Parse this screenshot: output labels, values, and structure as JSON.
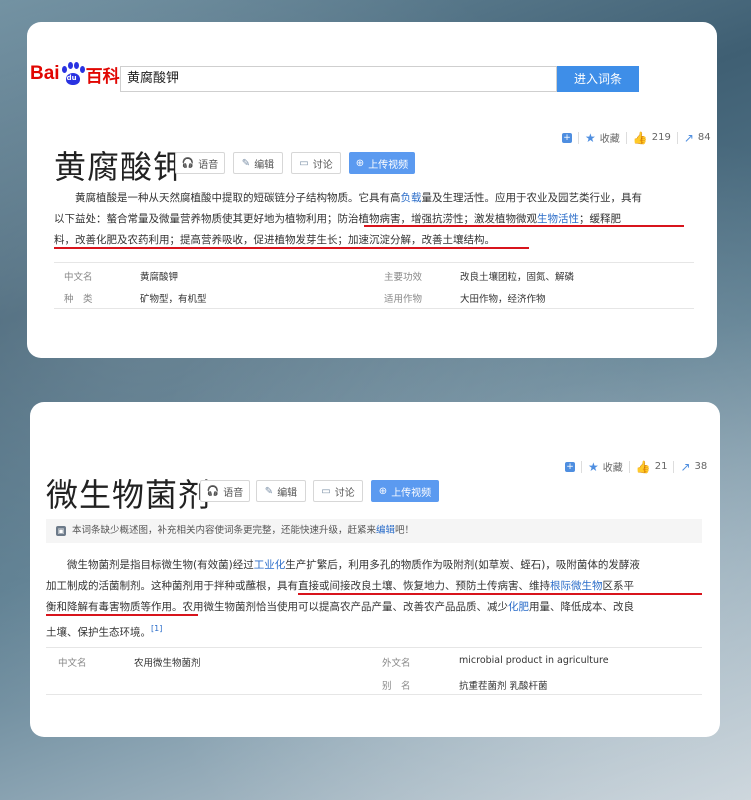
{
  "search": {
    "logo_bai": "Bai",
    "logo_du": "du",
    "logo_baike": "百科",
    "query": "黄腐酸钾",
    "button": "进入词条"
  },
  "entry1": {
    "toolbar": {
      "plus": "+",
      "collect": "收藏",
      "likes": "219",
      "shares": "84"
    },
    "title": "黄腐酸钾",
    "buttons": {
      "audio": "语音",
      "edit": "编辑",
      "discuss": "讨论",
      "upload": "上传视频"
    },
    "para_lines": [
      [
        "黄腐植酸是一种从天然腐植酸中提取的短碳链分子结构物质。它具有高",
        {
          "link": "负载"
        },
        "量及生理活性。应用于农业及园艺类行业，具有"
      ],
      [
        "以下益处：螯合常量及微量营养物质使其更好地为植物利用；防治植物病害，增强抗涝性；激发植物微观",
        {
          "link": "生物活性"
        },
        "；缓释肥"
      ],
      [
        "料，改善化肥及农药利用；提高营养吸收，促进植物发芽生长；加速沉淀分解，改善土壤结构。"
      ]
    ],
    "info": [
      {
        "k": "中文名",
        "v": "黄腐酸钾",
        "k2": "主要功效",
        "v2": "改良土壤团粒，固氮、解磷"
      },
      {
        "k": "种　类",
        "v": "矿物型，有机型",
        "k2": "适用作物",
        "v2": "大田作物，经济作物"
      }
    ]
  },
  "entry2": {
    "toolbar": {
      "plus": "+",
      "collect": "收藏",
      "likes": "21",
      "shares": "38"
    },
    "title": "微生物菌剂",
    "buttons": {
      "audio": "语音",
      "edit": "编辑",
      "discuss": "讨论",
      "upload": "上传视频"
    },
    "notice": {
      "text": "本词条缺少概述图，补充相关内容使词条更完整，还能快速升级，赶紧来",
      "link": "编辑",
      "tail": "吧！"
    },
    "para_lines": [
      [
        "微生物菌剂是指目标微生物(有效菌)经过",
        {
          "link": "工业化"
        },
        "生产扩繁后，利用多孔的物质作为吸附剂(如草炭、蛭石)，吸附菌体的发酵液"
      ],
      [
        "加工制成的活菌制剂。这种菌剂用于拌种或蘸根，具有直接或间接改良土壤、恢复地力、预防土传病害、维持",
        {
          "link": "根际微生物"
        },
        "区系平"
      ],
      [
        "衡和降解有毒害物质等作用。农用微生物菌剂恰当使用可以提高农产品产量、改善农产品品质、减少",
        {
          "link": "化肥"
        },
        "用量、降低成本、改良"
      ],
      [
        "土壤、保护生态环境。",
        {
          "sup": "[1]"
        }
      ]
    ],
    "info": [
      {
        "k": "中文名",
        "v": "农用微生物菌剂",
        "k2": "外文名",
        "v2": "microbial product in agriculture"
      },
      {
        "k": "",
        "v": "",
        "k2": "别　名",
        "v2": "抗重茬菌剂 乳酸杆菌"
      }
    ]
  }
}
